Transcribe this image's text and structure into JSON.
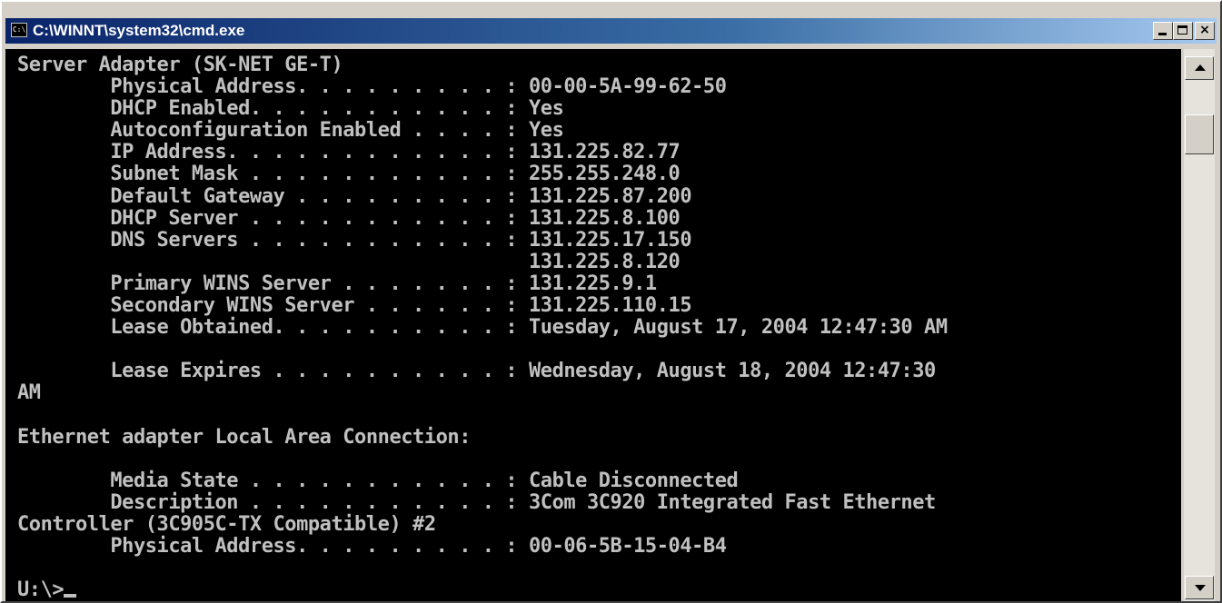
{
  "window": {
    "title": "C:\\WINNT\\system32\\cmd.exe",
    "icon_label": "C:\\",
    "controls": {
      "minimize": "_",
      "maximize": "□",
      "close": "×"
    }
  },
  "console": {
    "lines": [
      "Server Adapter (SK-NET GE-T)",
      "        Physical Address. . . . . . . . . : 00-00-5A-99-62-50",
      "        DHCP Enabled. . . . . . . . . . . : Yes",
      "        Autoconfiguration Enabled . . . . : Yes",
      "        IP Address. . . . . . . . . . . . : 131.225.82.77",
      "        Subnet Mask . . . . . . . . . . . : 255.255.248.0",
      "        Default Gateway . . . . . . . . . : 131.225.87.200",
      "        DHCP Server . . . . . . . . . . . : 131.225.8.100",
      "        DNS Servers . . . . . . . . . . . : 131.225.17.150",
      "                                            131.225.8.120",
      "        Primary WINS Server . . . . . . . : 131.225.9.1",
      "        Secondary WINS Server . . . . . . : 131.225.110.15",
      "        Lease Obtained. . . . . . . . . . : Tuesday, August 17, 2004 12:47:30 AM",
      "",
      "        Lease Expires . . . . . . . . . . : Wednesday, August 18, 2004 12:47:30",
      "AM",
      "",
      "Ethernet adapter Local Area Connection:",
      "",
      "        Media State . . . . . . . . . . . : Cable Disconnected",
      "        Description . . . . . . . . . . . : 3Com 3C920 Integrated Fast Ethernet",
      "Controller (3C905C-TX Compatible) #2",
      "        Physical Address. . . . . . . . . : 00-06-5B-15-04-B4",
      ""
    ],
    "prompt": "U:\\>"
  }
}
